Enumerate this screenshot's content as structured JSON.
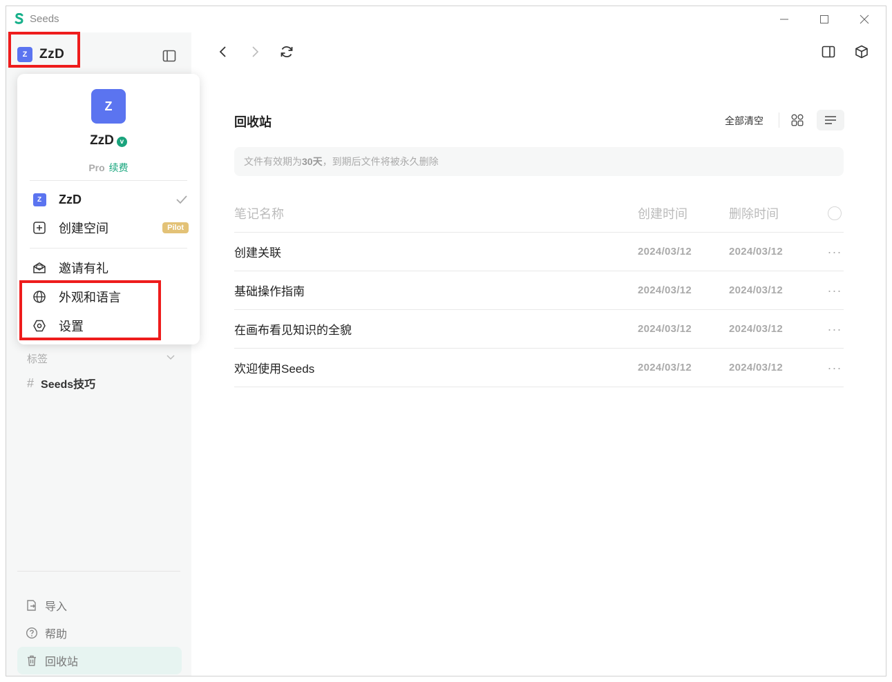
{
  "app": {
    "title": "Seeds"
  },
  "workspace": {
    "avatar_letter": "Z",
    "name": "ZzD"
  },
  "popup": {
    "avatar_letter": "Z",
    "user_name": "ZzD",
    "verified_mark": "v",
    "plan": "Pro",
    "renew": "续费",
    "workspaces": [
      {
        "avatar_letter": "Z",
        "name": "ZzD"
      }
    ],
    "create_space": "创建空间",
    "pilot_badge": "Pilot",
    "invite": "邀请有礼",
    "appearance_language": "外观和语言",
    "settings": "设置"
  },
  "sidebar": {
    "tags_label": "标签",
    "tags": [
      {
        "hash": "#",
        "name": "Seeds技巧"
      }
    ],
    "import": "导入",
    "help": "帮助",
    "trash": "回收站"
  },
  "main": {
    "title": "回收站",
    "clear_all": "全部清空",
    "notice_pre": "文件有效期为",
    "notice_days": "30天",
    "notice_post": "，到期后文件将被永久删除",
    "columns": {
      "name": "笔记名称",
      "created": "创建时间",
      "deleted": "删除时间"
    },
    "rows": [
      {
        "name": "创建关联",
        "created": "2024/03/12",
        "deleted": "2024/03/12"
      },
      {
        "name": "基础操作指南",
        "created": "2024/03/12",
        "deleted": "2024/03/12"
      },
      {
        "name": "在画布看见知识的全貌",
        "created": "2024/03/12",
        "deleted": "2024/03/12"
      },
      {
        "name": "欢迎使用Seeds",
        "created": "2024/03/12",
        "deleted": "2024/03/12"
      }
    ],
    "more": "···"
  },
  "colors": {
    "accent": "#17a67d",
    "avatar": "#5b74f0",
    "highlight": "#ee1c1c",
    "pilot": "#e3c277"
  }
}
